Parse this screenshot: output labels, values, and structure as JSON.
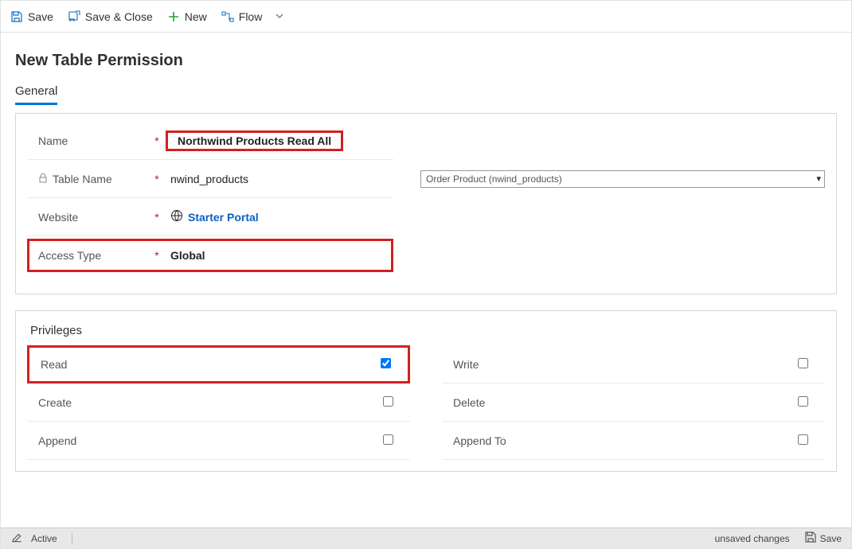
{
  "toolbar": {
    "save": "Save",
    "save_close": "Save & Close",
    "new": "New",
    "flow": "Flow"
  },
  "page_title": "New Table Permission",
  "tabs": {
    "general": "General"
  },
  "general": {
    "name_label": "Name",
    "name_value": "Northwind Products Read All",
    "table_label": "Table Name",
    "table_value": "nwind_products",
    "table_dropdown": "Order Product (nwind_products)",
    "website_label": "Website",
    "website_value": "Starter Portal",
    "access_label": "Access Type",
    "access_value": "Global"
  },
  "privileges": {
    "title": "Privileges",
    "read": "Read",
    "write": "Write",
    "create": "Create",
    "delete": "Delete",
    "append": "Append",
    "append_to": "Append To"
  },
  "footer": {
    "status": "Active",
    "unsaved": "unsaved changes",
    "save": "Save"
  }
}
